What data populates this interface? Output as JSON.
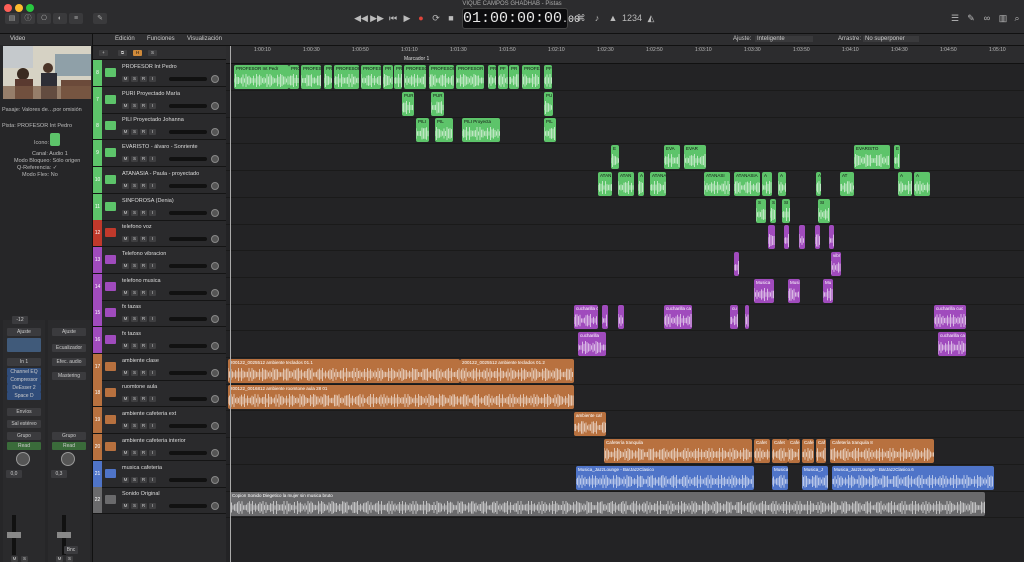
{
  "window": {
    "title": "VIQUE CAMPOS GHADHAB - Pistas"
  },
  "transport": {
    "time": "01:00:00:00",
    "time_small": ".00",
    "counter": "1234"
  },
  "toolbar": {
    "edit": "Edición",
    "functions": "Funciones",
    "view": "Visualización",
    "snap_label": "Ajuste:",
    "snap": "Inteligente",
    "drag_label": "Arrastre:",
    "drag": "No superponer"
  },
  "inspector": {
    "header": "Video",
    "region_label": "Pasaje:",
    "region_value": "Valores de…por omisión",
    "track_label": "Pista:",
    "track_value": "PROFESOR Int Pedro",
    "icon_label": "Icono:",
    "rows": [
      {
        "k": "Canal:",
        "v": "Audio 1"
      },
      {
        "k": "Modo Bloqueo:",
        "v": "Sólo origen"
      },
      {
        "k": "Q-Referencia:",
        "v": "✓"
      },
      {
        "k": "Modo Flex:",
        "v": "No"
      }
    ],
    "strip1": {
      "setting": "Ajuste",
      "eq": "EQ",
      "input": "In 1",
      "plugins": [
        "Channel EQ",
        "Compressor",
        "DeEsser 2",
        "Space D"
      ],
      "send": "Envíos",
      "output": "Sal estéreo",
      "group": "Grupo",
      "auto": "Read",
      "pan": "0,0",
      "mute": "M",
      "solo": "S",
      "db": "-12"
    },
    "strip2": {
      "setting": "Ajuste",
      "eq": "Ecualizador",
      "input": "Efec. audio",
      "fx": "Mastering",
      "group": "Grupo",
      "auto": "Read",
      "pan": "0,3",
      "mute": "M",
      "solo": "S",
      "out": "Bnc"
    }
  },
  "ruler": {
    "marker": "Marcador 1",
    "ticks": [
      "1:00:10",
      "1:00:30",
      "1:00:50",
      "1:01:10",
      "1:01:30",
      "1:01:50",
      "1:02:10",
      "1:02:30",
      "1:02:50",
      "1:03:10",
      "1:03:30",
      "1:03:50",
      "1:04:10",
      "1:04:30",
      "1:04:50",
      "1:05:10"
    ]
  },
  "tracks": [
    {
      "num": "8",
      "name": "PROFESOR Int Pedro",
      "type": "green"
    },
    {
      "num": "7",
      "name": "PURI Proyectado María",
      "type": "green"
    },
    {
      "num": "8",
      "name": "PILI Proyectado Johanna",
      "type": "green"
    },
    {
      "num": "9",
      "name": "EVARISTO - álvaro - Sonriente",
      "type": "green"
    },
    {
      "num": "10",
      "name": "ATANASIA - Paula - proyectado",
      "type": "green"
    },
    {
      "num": "11",
      "name": "SINFOROSA (Denia)",
      "type": "green"
    },
    {
      "num": "12",
      "name": "telefono voz",
      "type": "red"
    },
    {
      "num": "13",
      "name": "Telefono vibracion",
      "type": "purple"
    },
    {
      "num": "14",
      "name": "telefono musica",
      "type": "purple"
    },
    {
      "num": "15",
      "name": "fx tazas",
      "type": "purple"
    },
    {
      "num": "16",
      "name": "fx tazas",
      "type": "purple"
    },
    {
      "num": "17",
      "name": "ambiente clase",
      "type": "brown"
    },
    {
      "num": "18",
      "name": "ruomtone aula",
      "type": "brown"
    },
    {
      "num": "19",
      "name": "ambiente cafeteria ext",
      "type": "brown"
    },
    {
      "num": "20",
      "name": "ambiente cafeteria interior",
      "type": "brown"
    },
    {
      "num": "21",
      "name": "musica cafeteria",
      "type": "blue"
    },
    {
      "num": "22",
      "name": "Sonido Original",
      "type": "gray"
    }
  ],
  "regions": [
    {
      "t": 0,
      "c": "green",
      "items": [
        [
          8,
          55,
          "PROFESOR Int Pedr"
        ],
        [
          63,
          10,
          "PRO"
        ],
        [
          75,
          20,
          "PROFESOR Int"
        ],
        [
          98,
          8,
          "PR"
        ],
        [
          108,
          25,
          "PROFESOR"
        ],
        [
          135,
          20,
          "PROFESOR Int"
        ],
        [
          157,
          10,
          "PR"
        ],
        [
          168,
          8,
          "PR"
        ],
        [
          178,
          22,
          "PROFESOR"
        ],
        [
          203,
          25,
          "PROFESOR Int"
        ],
        [
          230,
          28,
          "PROFESOR Int Pedro"
        ],
        [
          262,
          8,
          "PR"
        ],
        [
          272,
          10,
          "PF"
        ],
        [
          283,
          10,
          "PR"
        ],
        [
          296,
          18,
          "PROFES"
        ],
        [
          318,
          8,
          "PF"
        ]
      ]
    },
    {
      "t": 1,
      "c": "green",
      "items": [
        [
          176,
          12,
          "PUR"
        ],
        [
          205,
          13,
          "PUR"
        ],
        [
          318,
          9,
          "PU"
        ]
      ]
    },
    {
      "t": 2,
      "c": "green",
      "items": [
        [
          190,
          13,
          "PILI"
        ],
        [
          209,
          18,
          "PIL"
        ],
        [
          236,
          38,
          "PILI Proyecta"
        ],
        [
          318,
          12,
          "PIL"
        ]
      ]
    },
    {
      "t": 3,
      "c": "green",
      "items": [
        [
          385,
          8,
          "E"
        ],
        [
          438,
          16,
          "EVA"
        ],
        [
          458,
          22,
          "EVAR"
        ],
        [
          628,
          36,
          "EVARISTO"
        ],
        [
          668,
          6,
          "E"
        ]
      ]
    },
    {
      "t": 4,
      "c": "green",
      "items": [
        [
          372,
          14,
          "ATAN"
        ],
        [
          392,
          16,
          "ATAN"
        ],
        [
          412,
          6,
          "A"
        ],
        [
          424,
          16,
          "ATANAS"
        ],
        [
          478,
          26,
          "ATANASI"
        ],
        [
          508,
          26,
          "ATANASIA"
        ],
        [
          536,
          10,
          "A"
        ],
        [
          552,
          8,
          "A"
        ],
        [
          590,
          5,
          "A"
        ],
        [
          614,
          14,
          "AT"
        ],
        [
          672,
          14,
          "A"
        ],
        [
          688,
          16,
          "A"
        ]
      ]
    },
    {
      "t": 5,
      "c": "green",
      "items": [
        [
          530,
          10,
          "S"
        ],
        [
          544,
          6,
          "S"
        ],
        [
          556,
          8,
          "SI"
        ],
        [
          592,
          12,
          "SI"
        ]
      ]
    },
    {
      "t": 6,
      "c": "purple",
      "items": [
        [
          542,
          7,
          ""
        ],
        [
          558,
          5,
          ""
        ],
        [
          573,
          6,
          ""
        ],
        [
          589,
          5,
          ""
        ],
        [
          603,
          5,
          ""
        ]
      ]
    },
    {
      "t": 7,
      "c": "purple",
      "items": [
        [
          508,
          5,
          ""
        ],
        [
          605,
          10,
          "vibr"
        ]
      ]
    },
    {
      "t": 8,
      "c": "purple",
      "items": [
        [
          528,
          20,
          "Musica"
        ],
        [
          562,
          12,
          "Musi"
        ],
        [
          597,
          10,
          "Mu"
        ]
      ]
    },
    {
      "t": 9,
      "c": "purple",
      "items": [
        [
          348,
          24,
          "cucharilla ca"
        ],
        [
          376,
          6,
          ""
        ],
        [
          392,
          6,
          ""
        ],
        [
          438,
          28,
          "cucharilla ca"
        ],
        [
          504,
          8,
          "cu"
        ],
        [
          519,
          4,
          ""
        ],
        [
          708,
          32,
          "cucharilla cuc"
        ]
      ]
    },
    {
      "t": 10,
      "c": "purple",
      "items": [
        [
          352,
          28,
          "cucharilla"
        ],
        [
          712,
          28,
          "cucharilla ca"
        ]
      ]
    },
    {
      "t": 11,
      "c": "brown",
      "items": [
        [
          2,
          232,
          "200122_0025512 ambiente teclados 01.1"
        ],
        [
          234,
          114,
          "200122_0025512 ambiente teclados 01.2"
        ]
      ]
    },
    {
      "t": 12,
      "c": "brown",
      "items": [
        [
          2,
          346,
          "200122_0016812 ambiente roomtone aula 28 01"
        ]
      ]
    },
    {
      "t": 13,
      "c": "brown",
      "items": [
        [
          348,
          32,
          "ambiente caf"
        ]
      ]
    },
    {
      "t": 14,
      "c": "brown",
      "items": [
        [
          378,
          148,
          "Cafetería tranquila"
        ],
        [
          528,
          16,
          "Cafet"
        ],
        [
          546,
          16,
          "Cafet"
        ],
        [
          562,
          12,
          "Cafe"
        ],
        [
          576,
          12,
          "Cafe"
        ],
        [
          590,
          10,
          "Caf"
        ],
        [
          604,
          104,
          "Cafetería tranquila 8"
        ]
      ]
    },
    {
      "t": 15,
      "c": "blue",
      "items": [
        [
          350,
          178,
          "Musica_JazzLounge - BarJazzClasico"
        ],
        [
          546,
          16,
          "Musica"
        ],
        [
          576,
          26,
          "Musica_J"
        ],
        [
          606,
          162,
          "Musica_JazzLounge - BarJazzClasico.6"
        ]
      ]
    },
    {
      "t": 16,
      "c": "gray",
      "items": [
        [
          4,
          755,
          "Copion Sonido Diegetico la mujer sin musica bruto"
        ]
      ]
    }
  ],
  "colors": {
    "green": "#5dc46a",
    "purple": "#a04bbd",
    "brown": "#b8713f",
    "blue": "#4f74c8",
    "gray": "#6a6a6c",
    "red": "#c0392b"
  }
}
